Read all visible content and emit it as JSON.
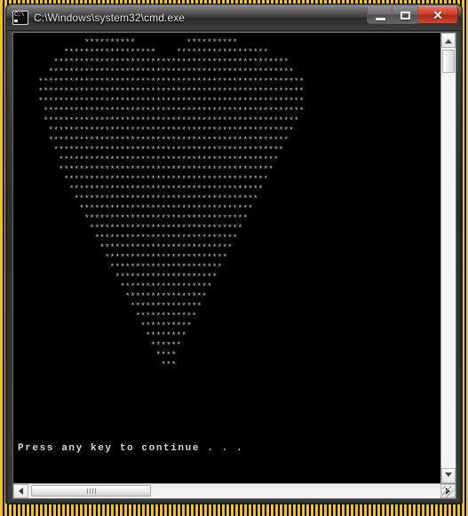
{
  "window": {
    "title": "C:\\Windows\\system32\\cmd.exe",
    "icon": "cmd-console-icon",
    "controls": {
      "minimize_label": "–",
      "maximize_label": "□",
      "close_label": "✕"
    },
    "accent_close_color": "#cf3b25",
    "titlebar_color": "#3a3a3a"
  },
  "desktop": {
    "background_pattern": "hazard-tape",
    "pattern_colors": [
      "#f2c415",
      "#000000"
    ]
  },
  "console": {
    "background_color": "#000000",
    "text_color": "#c8c8c8",
    "art_name": "ascii-heart",
    "art": "             **********          **********\n         ******************    ******************\n       **********************************************\n      ************************************************\n    ****************************************************\n    ****************************************************\n    ****************************************************\n     ***************************************************\n     **************************************************\n      ************************************************\n      ***********************************************\n       *********************************************\n        *******************************************\n        ******************************************\n         ****************************************\n          **************************************\n           ************************************\n            **********************************\n             ********************************\n              ******************************\n               ****************************\n                **************************\n                 ************************\n                  **********************\n                   ********************\n                    ******************\n                     ****************\n                      **************\n                       ************\n                        **********\n                         ********\n                          ******\n                           ****\n                            ***",
    "prompt_message": "Press any key to continue . . ."
  },
  "scrollbars": {
    "vertical": {
      "up_arrow": "scroll-up-arrow",
      "down_arrow": "scroll-down-arrow",
      "thumb_position": "top"
    },
    "horizontal": {
      "left_arrow": "scroll-left-arrow",
      "right_arrow": "scroll-right-arrow",
      "thumb_position": "left"
    },
    "resize_grip": "resize-grip"
  }
}
